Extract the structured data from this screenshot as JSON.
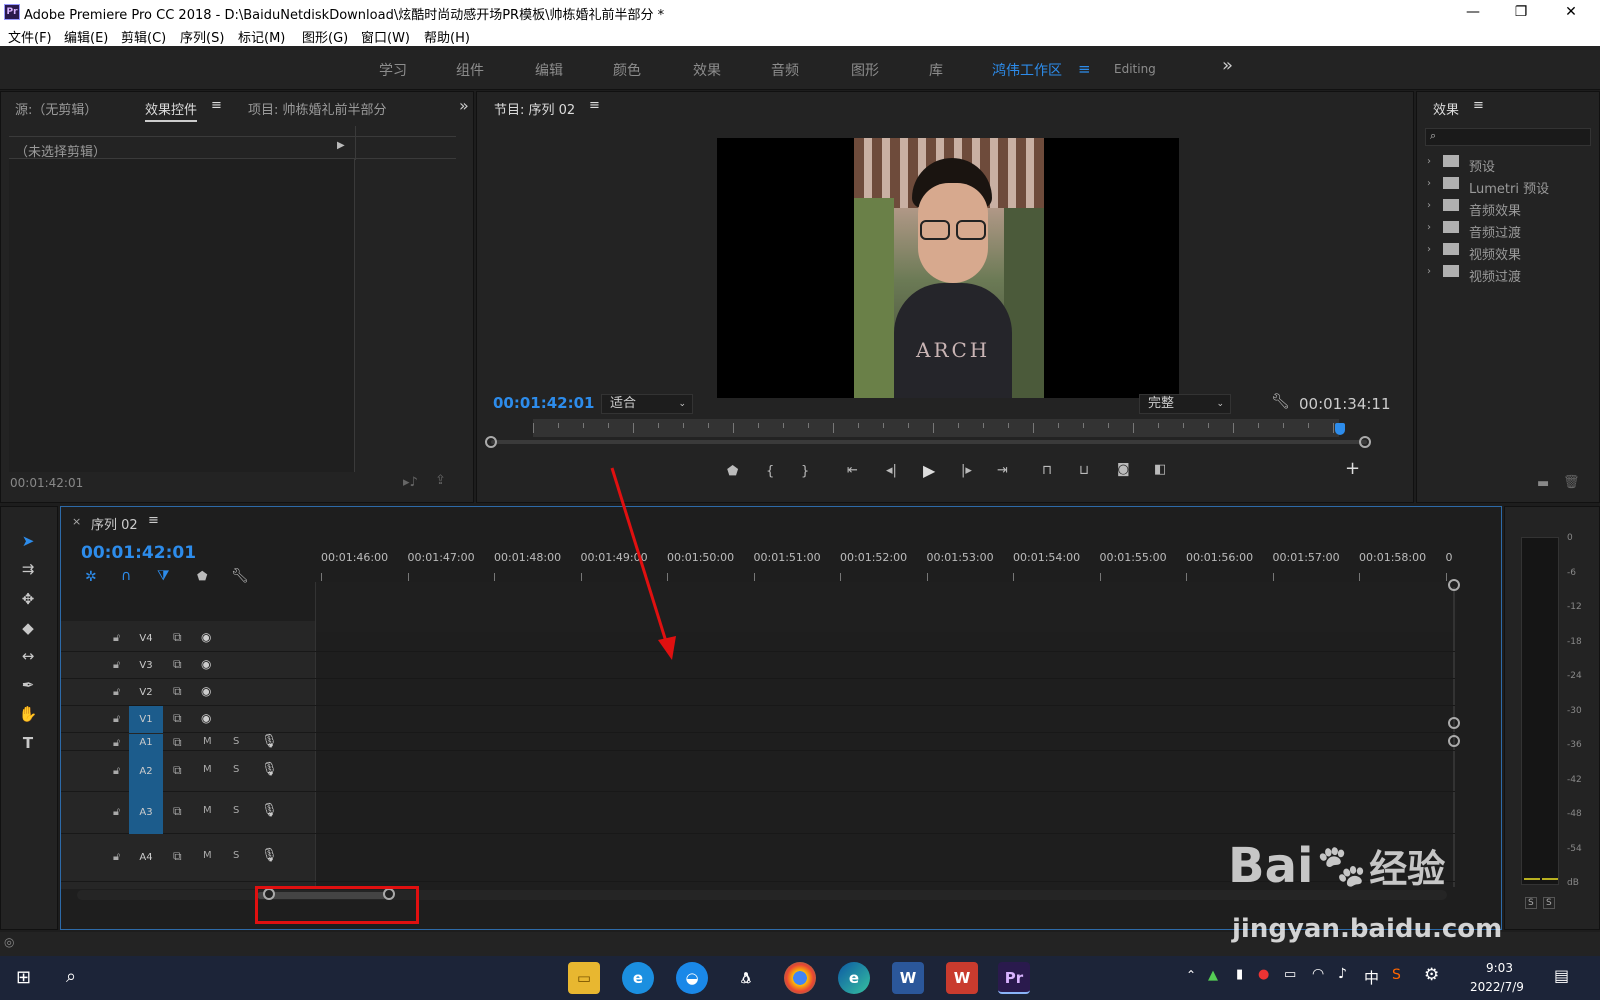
{
  "window": {
    "app_icon": "Pr",
    "title": "Adobe Premiere Pro CC 2018 - D:\\BaiduNetdiskDownload\\炫酷时尚动感开场PR模板\\帅栋婚礼前半部分 *",
    "minimize": "—",
    "maximize": "❐",
    "close": "✕"
  },
  "menu": [
    "文件(F)",
    "编辑(E)",
    "剪辑(C)",
    "序列(S)",
    "标记(M)",
    "图形(G)",
    "窗口(W)",
    "帮助(H)"
  ],
  "workspace": {
    "tabs": [
      "学习",
      "组件",
      "编辑",
      "颜色",
      "效果",
      "音频",
      "图形",
      "库"
    ],
    "active_tab": "鸿伟工作区",
    "extra_tab": "Editing",
    "overflow": "»"
  },
  "source_panel": {
    "tabs": [
      "源:（无剪辑）",
      "效果控件",
      "项目: 帅栋婚礼前半部分"
    ],
    "no_clip_label": "（未选择剪辑）",
    "timecode": "00:01:42:01",
    "overflow": "»"
  },
  "program_monitor": {
    "title": "节目: 序列 02",
    "timecode_left": "00:01:42:01",
    "fit_select": "适合",
    "quality_select": "完整",
    "timecode_right": "00:01:34:11",
    "add": "+"
  },
  "effects_panel": {
    "title": "效果",
    "items": [
      "预设",
      "Lumetri 预设",
      "音频效果",
      "音频过渡",
      "视频效果",
      "视频过渡"
    ]
  },
  "timeline": {
    "close": "×",
    "sequence_name": "序列 02",
    "timecode": "00:01:42:01",
    "ruler_labels": [
      "00:01:46:00",
      "00:01:47:00",
      "00:01:48:00",
      "00:01:49:00",
      "00:01:50:00",
      "00:01:51:00",
      "00:01:52:00",
      "00:01:53:00",
      "00:01:54:00",
      "00:01:55:00",
      "00:01:56:00",
      "00:01:57:00",
      "00:01:58:00",
      "0"
    ],
    "video_tracks": [
      "V4",
      "V3",
      "V2",
      "V1"
    ],
    "audio_tracks": [
      "A1",
      "A2",
      "A3",
      "A4"
    ],
    "mute": "M",
    "solo": "S"
  },
  "audio_meter": {
    "labels": [
      "0",
      "-6",
      "-12",
      "-18",
      "-24",
      "-30",
      "-36",
      "-42",
      "-48",
      "-54",
      "dB"
    ],
    "solo_left": "S",
    "solo_right": "S"
  },
  "watermark": {
    "brand": "Bai",
    "brand_suffix": "经验",
    "url": "jingyan.baidu.com"
  },
  "taskbar": {
    "time": "9:03",
    "date": "2022/7/9",
    "ime": "中"
  },
  "colors": {
    "accent": "#2d8ceb",
    "annotation_red": "#e01010",
    "panel_bg": "#232323",
    "track_selected": "#1c5c8c"
  }
}
